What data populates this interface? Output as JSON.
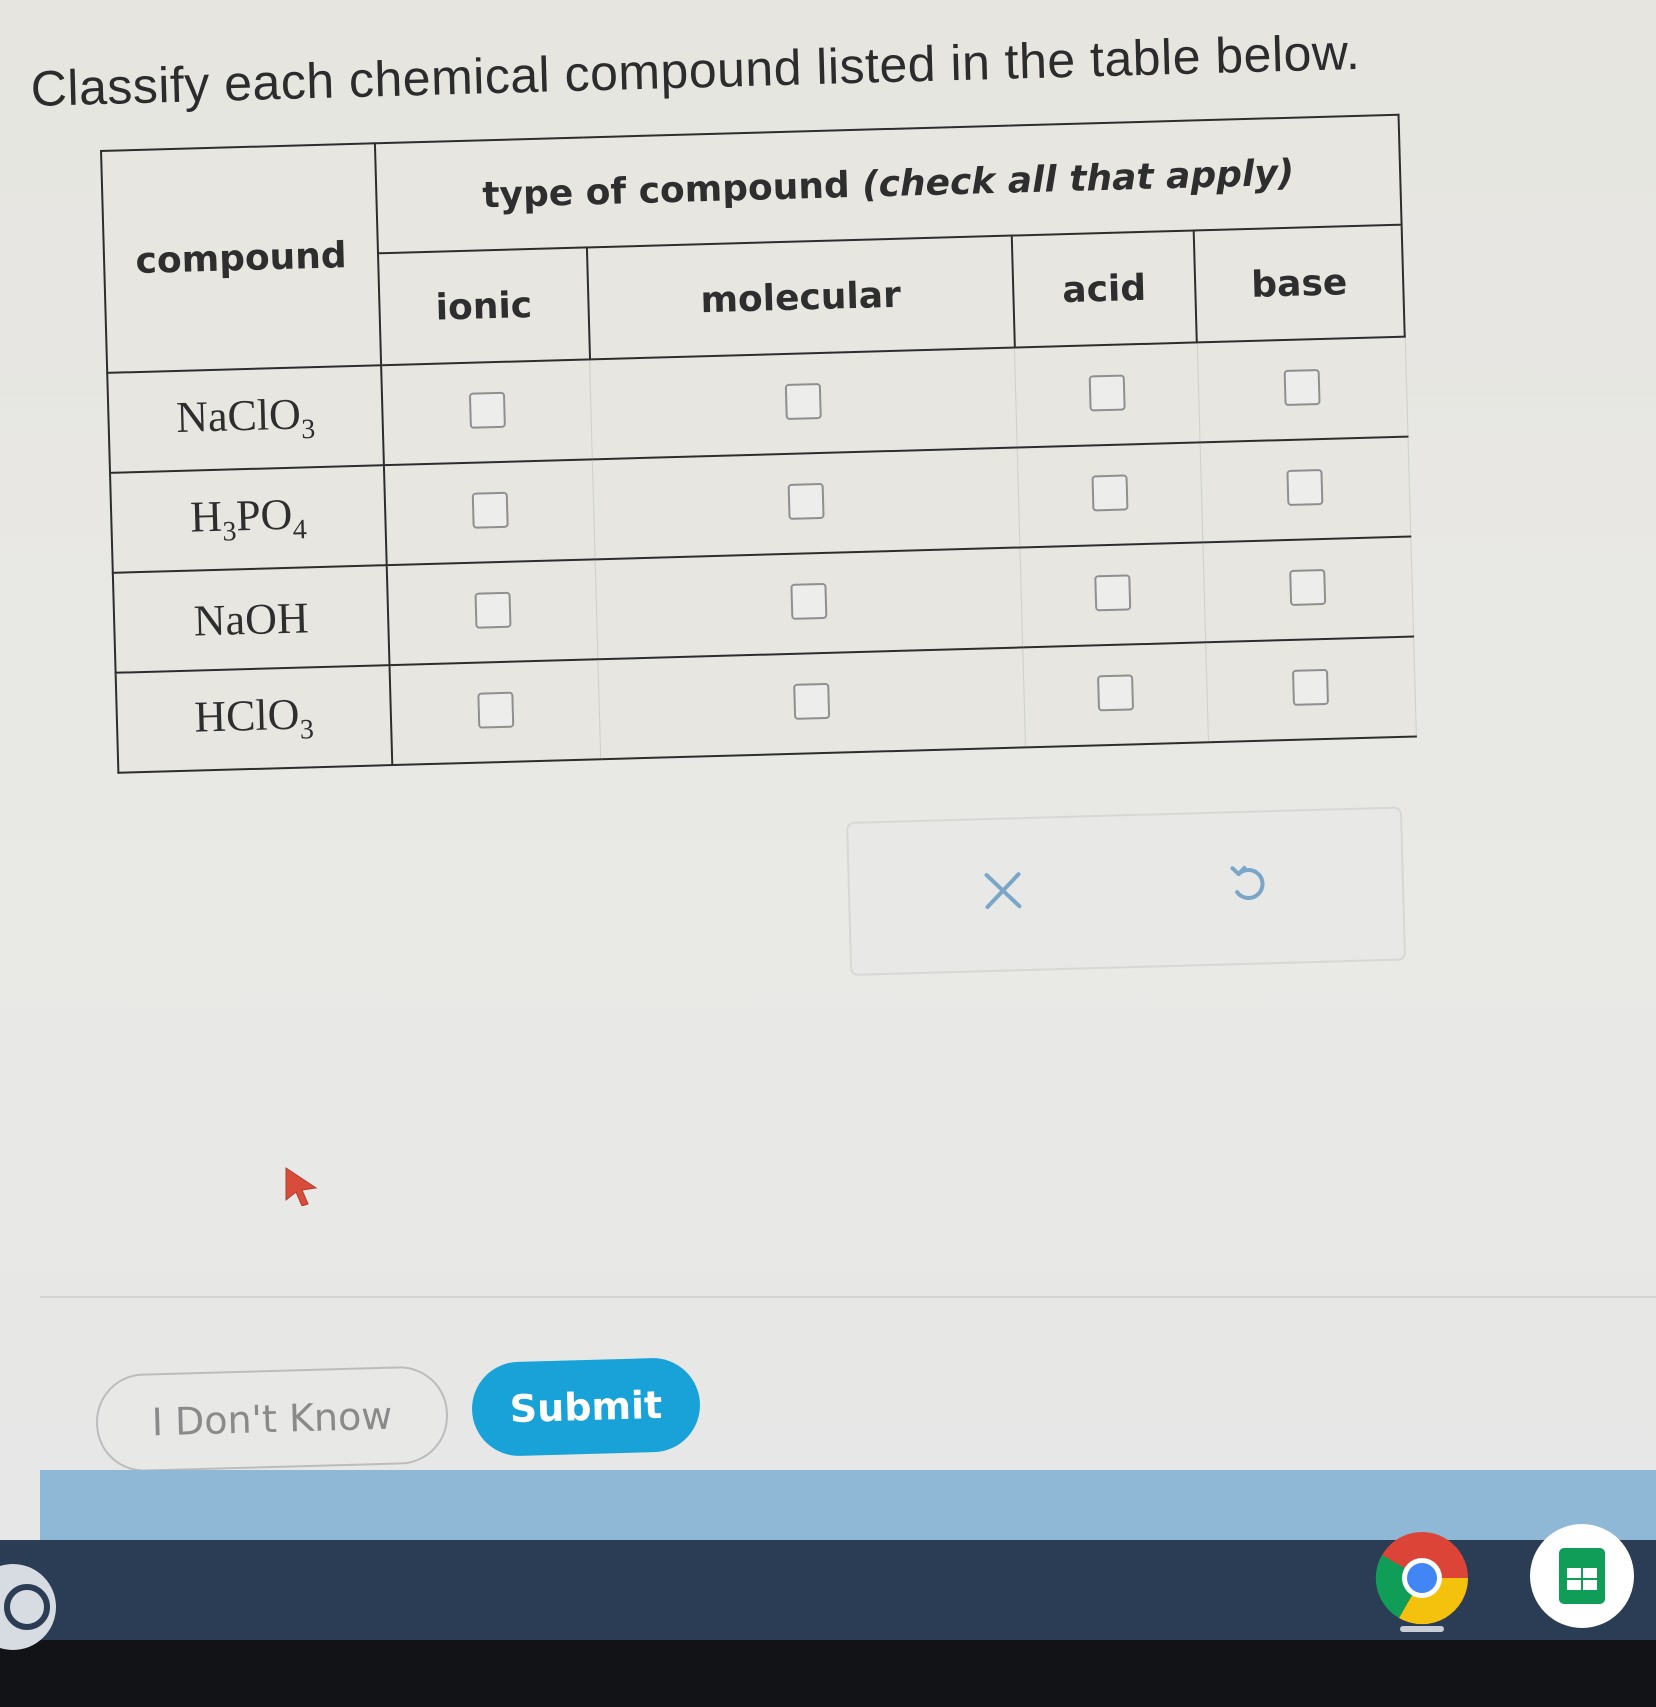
{
  "prompt": "Classify each chemical compound listed in the table below.",
  "table": {
    "compound_header": "compound",
    "group_header": "type of compound",
    "group_header_note": "(check all that apply)",
    "columns": [
      "ionic",
      "molecular",
      "acid",
      "base"
    ],
    "rows": [
      {
        "base": "NaClO",
        "sub": "3",
        "tail": ""
      },
      {
        "base": "H",
        "sub": "3",
        "tail": "PO",
        "sub2": "4"
      },
      {
        "base": "NaOH",
        "sub": "",
        "tail": ""
      },
      {
        "base": "HClO",
        "sub": "3",
        "tail": ""
      }
    ]
  },
  "actions": {
    "clear_icon": "x-icon",
    "undo_icon": "undo-icon"
  },
  "buttons": {
    "dont_know": "I Don't Know",
    "submit": "Submit"
  },
  "colors": {
    "submit_bg": "#19a2d8",
    "action_icon": "#7aa6c8",
    "taskbar": "#2b3d55"
  },
  "taskbar": {
    "apps": [
      "chrome-icon",
      "sheets-icon"
    ]
  }
}
